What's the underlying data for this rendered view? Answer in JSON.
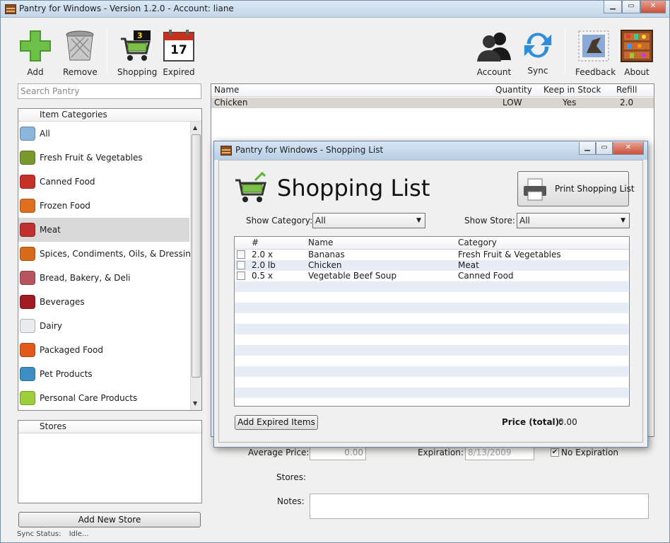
{
  "main_window": {
    "title": "Pantry for Windows - Version 1.2.0 - Account: liane",
    "toolbar": {
      "add": "Add",
      "remove": "Remove",
      "shopping": "Shopping",
      "shopping_badge": "3",
      "expired": "Expired",
      "expired_day": "17",
      "account": "Account",
      "sync": "Sync",
      "feedback": "Feedback",
      "about": "About"
    },
    "search_placeholder": "Search Pantry",
    "categories_header": "Item Categories",
    "categories": [
      {
        "label": "All",
        "icon": "magnifier-icon",
        "color": "#8ab6da"
      },
      {
        "label": "Fresh Fruit & Vegetables",
        "icon": "kiwi-icon",
        "color": "#7a9a2e"
      },
      {
        "label": "Canned Food",
        "icon": "can-icon",
        "color": "#c8302a"
      },
      {
        "label": "Frozen Food",
        "icon": "frozen-icon",
        "color": "#e07020"
      },
      {
        "label": "Meat",
        "icon": "steak-icon",
        "color": "#c03030"
      },
      {
        "label": "Spices, Condiments, Oils, & Dressings",
        "icon": "bottle-icon",
        "color": "#d86a1a"
      },
      {
        "label": "Bread, Bakery, & Deli",
        "icon": "bread-icon",
        "color": "#b8545e"
      },
      {
        "label": "Beverages",
        "icon": "wine-icon",
        "color": "#a01b22"
      },
      {
        "label": "Dairy",
        "icon": "milk-icon",
        "color": "#e8ecef"
      },
      {
        "label": "Packaged Food",
        "icon": "chips-icon",
        "color": "#e2591c"
      },
      {
        "label": "Pet Products",
        "icon": "pet-bowl-icon",
        "color": "#3b8fc4"
      },
      {
        "label": "Personal Care Products",
        "icon": "lotion-icon",
        "color": "#9ccf3a"
      }
    ],
    "stores_header": "Stores",
    "add_store_button": "Add New Store",
    "sync_status_label": "Sync Status:",
    "sync_status_value": "Idle...",
    "items_table": {
      "columns": [
        "Name",
        "Quantity",
        "Keep in Stock",
        "Refill"
      ],
      "rows": [
        {
          "name": "Chicken",
          "quantity": "LOW",
          "keep": "Yes",
          "refill": "2.0"
        }
      ]
    },
    "details": {
      "average_price_label": "Average Price:",
      "average_price_value": "0.00",
      "expiration_label": "Expiration:",
      "expiration_value": "8/13/2009",
      "no_expiration_label": "No Expiration",
      "stores_label": "Stores:",
      "notes_label": "Notes:"
    }
  },
  "dialog": {
    "title": "Pantry for Windows - Shopping List",
    "heading": "Shopping List",
    "print_button": "Print Shopping List",
    "show_category_label": "Show Category:",
    "show_category_value": "All",
    "show_store_label": "Show Store:",
    "show_store_value": "All",
    "columns": [
      "#",
      "Name",
      "Category"
    ],
    "rows": [
      {
        "qty": "2.0 x",
        "name": "Bananas",
        "category": "Fresh Fruit & Vegetables"
      },
      {
        "qty": "2.0 lb",
        "name": "Chicken",
        "category": "Meat"
      },
      {
        "qty": "0.5 x",
        "name": "Vegetable Beef Soup",
        "category": "Canned Food"
      }
    ],
    "add_expired_button": "Add Expired Items",
    "price_total_label": "Price (total):",
    "price_total_value": "0.00"
  },
  "colors": {
    "stripe": "#e6edf7",
    "selected_row": "#d9d6cf",
    "accent_green": "#4a9a2a"
  }
}
